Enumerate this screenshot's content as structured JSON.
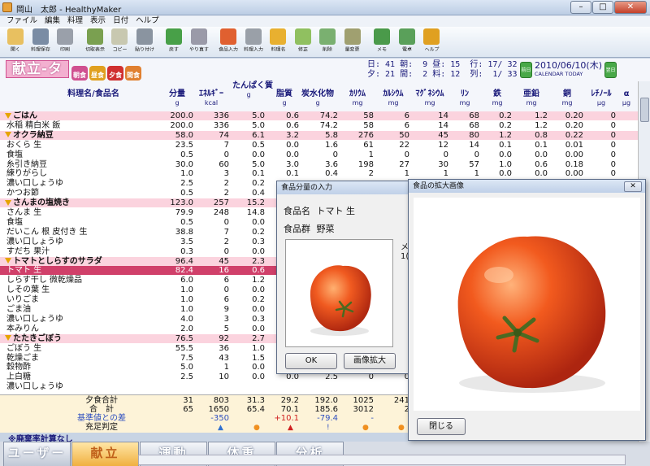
{
  "window": {
    "title": "岡山　太郎 - HealthyMaker"
  },
  "menu": [
    "ファイル",
    "編集",
    "料理",
    "表示",
    "日付",
    "ヘルプ"
  ],
  "toolbar": [
    {
      "label": "開く",
      "color": "#e8c060"
    },
    {
      "label": "料理保存",
      "color": "#7a8ca4"
    },
    {
      "label": "印刷",
      "color": "#9aa0aa"
    },
    {
      "label": "切取表示",
      "color": "#7aa050"
    },
    {
      "label": "コピー",
      "color": "#c8c8b0"
    },
    {
      "label": "貼り付け",
      "color": "#8a94a0"
    },
    {
      "label": "戻す",
      "color": "#48a048"
    },
    {
      "label": "やり直す",
      "color": "#9a9aa8"
    },
    {
      "label": "食品入力",
      "color": "#e06030"
    },
    {
      "label": "料理入力",
      "color": "#9aa0a8"
    },
    {
      "label": "料理名",
      "color": "#e8b030"
    },
    {
      "label": "修正",
      "color": "#90c060"
    },
    {
      "label": "削除",
      "color": "#7ab070"
    },
    {
      "label": "量変更",
      "color": "#a0a070"
    },
    {
      "label": "メモ",
      "color": "#4a9a4a"
    },
    {
      "label": "電卓",
      "color": "#5aa05a"
    },
    {
      "label": "ヘルプ",
      "color": "#e0a020"
    }
  ],
  "header": {
    "title": "献立-タ",
    "meals": [
      {
        "label": "朝食",
        "color": "#d05090"
      },
      {
        "label": "昼食",
        "color": "#e0a020"
      },
      {
        "label": "夕食",
        "color": "#d03030"
      },
      {
        "label": "間食",
        "color": "#e08030"
      }
    ],
    "stats_line1": "日: 41 朝:  9 昼: 15  行: 17/ 32",
    "stats_line2": "夕: 21 間:  2 料: 12  列:  1/ 33",
    "prev_label": "前日",
    "next_label": "翌日",
    "date": "2010/06/10(木)",
    "calendar_label": "CALENDAR",
    "today_label": "TODAY"
  },
  "columns": {
    "name": "料理名/食品名",
    "headers": [
      {
        "l1": "分量",
        "l2": "g"
      },
      {
        "l1": "ｴﾈﾙｷﾞｰ",
        "l2": "kcal"
      },
      {
        "l1": "たんぱく質",
        "l2": "g"
      },
      {
        "l1": "脂質",
        "l2": "g"
      },
      {
        "l1": "炭水化物",
        "l2": "g"
      },
      {
        "l1": "ｶﾘｳﾑ",
        "l2": "mg"
      },
      {
        "l1": "ｶﾙｼｳﾑ",
        "l2": "mg"
      },
      {
        "l1": "ﾏｸﾞﾈｼｳﾑ",
        "l2": "mg"
      },
      {
        "l1": "ﾘﾝ",
        "l2": "mg"
      },
      {
        "l1": "鉄",
        "l2": "mg"
      },
      {
        "l1": "亜鉛",
        "l2": "mg"
      },
      {
        "l1": "銅",
        "l2": "mg"
      },
      {
        "l1": "ﾚﾁﾉｰﾙ",
        "l2": "μg"
      },
      {
        "l1": "α",
        "l2": "μg"
      }
    ]
  },
  "rows": [
    {
      "t": "grp",
      "n": "ごはん",
      "v": [
        "200.0",
        "336",
        "5.0",
        "0.6",
        "74.2",
        "58",
        "6",
        "14",
        "68",
        "0.2",
        "1.2",
        "0.20",
        "0"
      ]
    },
    {
      "t": "item",
      "n": "水稲 精白米 飯",
      "v": [
        "200.0",
        "336",
        "5.0",
        "0.6",
        "74.2",
        "58",
        "6",
        "14",
        "68",
        "0.2",
        "1.2",
        "0.20",
        "0"
      ]
    },
    {
      "t": "grp",
      "n": "オクラ納豆",
      "v": [
        "58.0",
        "74",
        "6.1",
        "3.2",
        "5.8",
        "276",
        "50",
        "45",
        "80",
        "1.2",
        "0.8",
        "0.22",
        "0"
      ]
    },
    {
      "t": "item",
      "n": "おくら 生",
      "v": [
        "23.5",
        "7",
        "0.5",
        "0.0",
        "1.6",
        "61",
        "22",
        "12",
        "14",
        "0.1",
        "0.1",
        "0.01",
        "0"
      ]
    },
    {
      "t": "item",
      "n": "食塩",
      "v": [
        "0.5",
        "0",
        "0.0",
        "0.0",
        "0",
        "1",
        "0",
        "0",
        "0",
        "0.0",
        "0.0",
        "0.00",
        "0"
      ]
    },
    {
      "t": "item",
      "n": "糸引き納豆",
      "v": [
        "30.0",
        "60",
        "5.0",
        "3.0",
        "3.6",
        "198",
        "27",
        "30",
        "57",
        "1.0",
        "0.6",
        "0.18",
        "0"
      ]
    },
    {
      "t": "item",
      "n": "練りがらし",
      "v": [
        "1.0",
        "3",
        "0.1",
        "0.1",
        "0.4",
        "2",
        "1",
        "1",
        "1",
        "0.0",
        "0.0",
        "0.00",
        "0"
      ]
    },
    {
      "t": "item",
      "n": "濃い口しょうゆ",
      "v": [
        "2.5",
        "2",
        "0.2",
        "",
        "",
        "",
        "",
        "",
        "",
        "",
        "",
        "",
        ""
      ]
    },
    {
      "t": "item",
      "n": "かつお節",
      "v": [
        "0.5",
        "2",
        "0.4",
        "",
        "",
        "",
        "",
        "",
        "",
        "",
        "",
        "",
        ""
      ]
    },
    {
      "t": "grp",
      "n": "さんまの塩焼き",
      "v": [
        "123.0",
        "257",
        "15.2",
        "",
        "",
        "",
        "",
        "",
        "",
        "",
        "",
        "",
        ""
      ]
    },
    {
      "t": "item",
      "n": "さんま 生",
      "v": [
        "79.9",
        "248",
        "14.8",
        "",
        "",
        "",
        "",
        "",
        "",
        "",
        "",
        "",
        ""
      ]
    },
    {
      "t": "item",
      "n": "食塩",
      "v": [
        "0.5",
        "0",
        "0.0",
        "",
        "",
        "",
        "",
        "",
        "",
        "",
        "",
        "",
        ""
      ]
    },
    {
      "t": "item",
      "n": "だいこん 根 皮付き 生",
      "v": [
        "38.8",
        "7",
        "0.2",
        "",
        "",
        "",
        "",
        "",
        "",
        "",
        "",
        "",
        ""
      ]
    },
    {
      "t": "item",
      "n": "濃い口しょうゆ",
      "v": [
        "3.5",
        "2",
        "0.3",
        "",
        "",
        "",
        "",
        "",
        "",
        "",
        "",
        "",
        ""
      ]
    },
    {
      "t": "item",
      "n": "すだち 果汁",
      "v": [
        "0.3",
        "0",
        "0.0",
        "",
        "",
        "",
        "",
        "",
        "",
        "",
        "",
        "",
        ""
      ]
    },
    {
      "t": "grp",
      "n": "トマトとしらすのサラダ",
      "v": [
        "96.4",
        "45",
        "2.3",
        "",
        "",
        "",
        "",
        "",
        "",
        "",
        "",
        "",
        ""
      ]
    },
    {
      "t": "sel",
      "n": "トマト 生",
      "v": [
        "82.4",
        "16",
        "0.6",
        "",
        "",
        "",
        "",
        "",
        "",
        "",
        "",
        "",
        ""
      ]
    },
    {
      "t": "item",
      "n": "しらす干し 微乾燥品",
      "v": [
        "6.0",
        "6",
        "1.2",
        "",
        "",
        "",
        "",
        "",
        "",
        "",
        "",
        "",
        ""
      ]
    },
    {
      "t": "item",
      "n": "しその葉 生",
      "v": [
        "1.0",
        "0",
        "0.0",
        "",
        "",
        "",
        "",
        "",
        "",
        "",
        "",
        "",
        ""
      ]
    },
    {
      "t": "item",
      "n": "いりごま",
      "v": [
        "1.0",
        "6",
        "0.2",
        "",
        "",
        "",
        "",
        "",
        "",
        "",
        "",
        "",
        ""
      ]
    },
    {
      "t": "item",
      "n": "ごま油",
      "v": [
        "1.0",
        "9",
        "0.0",
        "",
        "",
        "",
        "",
        "",
        "",
        "",
        "",
        "",
        ""
      ]
    },
    {
      "t": "item",
      "n": "濃い口しょうゆ",
      "v": [
        "4.0",
        "3",
        "0.3",
        "",
        "",
        "",
        "",
        "",
        "",
        "",
        "",
        "",
        ""
      ]
    },
    {
      "t": "item",
      "n": "本みりん",
      "v": [
        "2.0",
        "5",
        "0.0",
        "",
        "",
        "",
        "",
        "",
        "",
        "",
        "",
        "",
        ""
      ]
    },
    {
      "t": "grp",
      "n": "たたきごぼう",
      "v": [
        "76.5",
        "92",
        "2.7",
        "",
        "",
        "",
        "",
        "",
        "",
        "",
        "",
        "",
        ""
      ]
    },
    {
      "t": "item",
      "n": "ごぼう 生",
      "v": [
        "55.5",
        "36",
        "1.0",
        "",
        "",
        "",
        "",
        "",
        "",
        "",
        "",
        "",
        ""
      ]
    },
    {
      "t": "item",
      "n": "乾燥ごま",
      "v": [
        "7.5",
        "43",
        "1.5",
        "",
        "",
        "",
        "",
        "",
        "",
        "",
        "",
        "",
        ""
      ]
    },
    {
      "t": "item",
      "n": "穀物酢",
      "v": [
        "5.0",
        "1",
        "0.0",
        "",
        "",
        "",
        "",
        "",
        "",
        "",
        "",
        "",
        ""
      ]
    },
    {
      "t": "item",
      "n": "上白糖",
      "v": [
        "2.5",
        "10",
        "0.0",
        "0.0",
        "2.5",
        "0",
        "0",
        "",
        "",
        "",
        "",
        "",
        ""
      ]
    },
    {
      "t": "item",
      "n": "濃い口しょうゆ",
      "v": [
        "",
        "",
        "",
        "",
        "",
        "",
        "",
        "",
        "",
        "",
        "",
        "",
        ""
      ]
    }
  ],
  "totals": [
    {
      "label": "夕食合計",
      "cls": "",
      "v": [
        "31",
        "803",
        "31.3",
        "29.2",
        "192.0",
        "1025",
        "241",
        "",
        "",
        "",
        "",
        "",
        ""
      ]
    },
    {
      "label": "合　計",
      "cls": "",
      "v": [
        "65",
        "1650",
        "65.4",
        "70.1",
        "185.6",
        "3012",
        "2",
        "",
        "",
        "",
        "",
        "",
        ""
      ]
    },
    {
      "label": "基準値との差",
      "cls": "blue",
      "v": [
        "",
        "-350",
        "",
        "+10.1",
        "-79.4",
        "-",
        "",
        "",
        "",
        "",
        "",
        "",
        ""
      ]
    },
    {
      "label": "充足判定",
      "cls": "",
      "v": [
        "",
        "",
        "",
        "",
        "",
        "",
        "",
        "",
        "",
        "",
        "",
        "",
        ""
      ]
    }
  ],
  "footnote": "※廃棄率計算なし",
  "tabs": [
    "ユーザー",
    "献立",
    "運動",
    "体重",
    "分析"
  ],
  "dialog_input": {
    "title": "食品分量の入力",
    "food_name_label": "食品名",
    "food_name_value": "トマト 生",
    "food_group_label": "食品群",
    "food_group_value": "野菜",
    "side_label": "メ",
    "side_value": "1(",
    "ok_label": "OK",
    "zoom_label": "画像拡大"
  },
  "dialog_zoom": {
    "title": "食品の拡大画像",
    "close_label": "閉じる"
  }
}
